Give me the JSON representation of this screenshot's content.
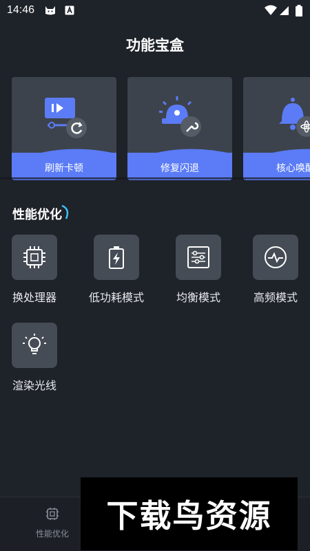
{
  "status_bar": {
    "time": "14:46",
    "left_icons": [
      "cat-icon",
      "a-letter-icon"
    ],
    "right_icons": [
      "wifi-icon",
      "signal-icon",
      "battery-icon"
    ]
  },
  "page": {
    "title": "功能宝盒"
  },
  "cards": [
    {
      "label": "刷新卡顿",
      "icon": "refresh-screen-icon"
    },
    {
      "label": "修复闪退",
      "icon": "siren-repair-icon"
    },
    {
      "label": "核心唤醒",
      "icon": "bell-atom-icon"
    }
  ],
  "section": {
    "title": "性能优化"
  },
  "features": [
    {
      "label": "换处理器",
      "icon": "cpu-chip-icon"
    },
    {
      "label": "低功耗模式",
      "icon": "battery-bolt-icon"
    },
    {
      "label": "均衡模式",
      "icon": "sliders-icon"
    },
    {
      "label": "高频模式",
      "icon": "pulse-icon"
    },
    {
      "label": "渲染光线",
      "icon": "lightbulb-icon"
    }
  ],
  "bottom_nav": {
    "items": [
      {
        "label": "性能优化",
        "icon": "performance-icon"
      }
    ]
  },
  "watermark": {
    "text": "下载鸟资源"
  },
  "colors": {
    "background": "#1e2229",
    "card": "#3d434c",
    "accent": "#5b7cf6",
    "tile": "#464c55"
  }
}
